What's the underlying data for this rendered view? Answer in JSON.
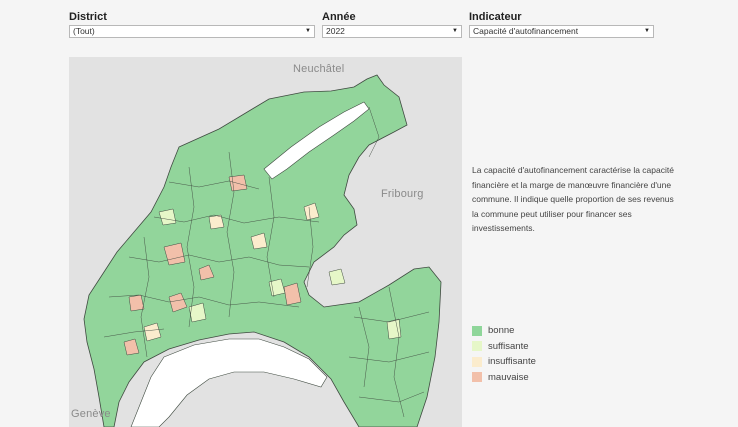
{
  "filters": {
    "district": {
      "label": "District",
      "value": "(Tout)"
    },
    "annee": {
      "label": "Année",
      "value": "2022"
    },
    "indicateur": {
      "label": "Indicateur",
      "value": "Capacité d'autofinancement"
    }
  },
  "map": {
    "labels": {
      "neuchatel": "Neuchâtel",
      "fribourg": "Fribourg",
      "geneve": "Genève"
    }
  },
  "description": "La capacité d'autofinancement caractérise la capacité financière et la marge de manœuvre financière d'une commune. Il indique quelle proportion de ses revenus la commune peut utiliser pour financer ses investissements.",
  "legend": [
    {
      "label": "bonne",
      "color": "#8fd69a"
    },
    {
      "label": "suffisante",
      "color": "#e6f7c8"
    },
    {
      "label": "insuffisante",
      "color": "#fbeccd"
    },
    {
      "label": "mauvaise",
      "color": "#f2c0aa"
    }
  ]
}
